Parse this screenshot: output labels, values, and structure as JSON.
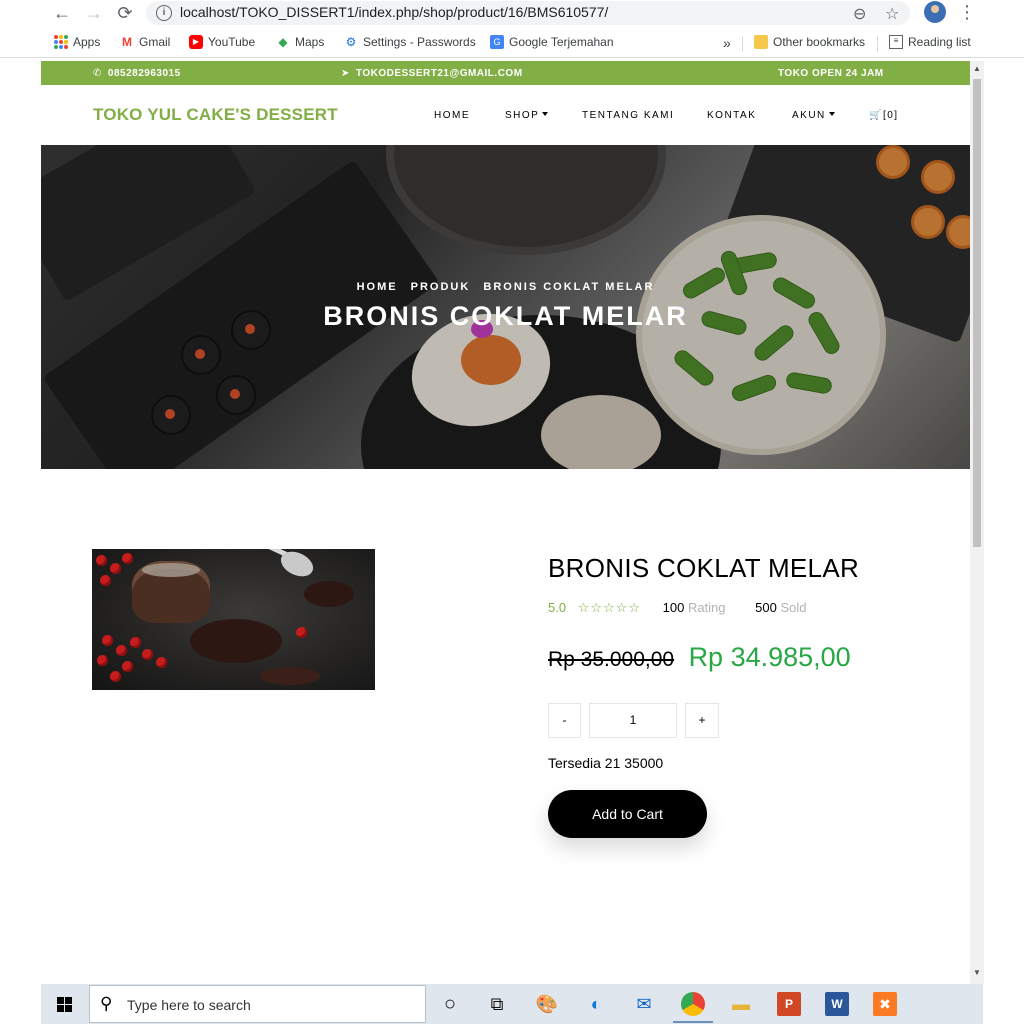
{
  "browser": {
    "url_host": "localhost",
    "url_path": "/TOKO_DISSERT1/index.php/shop/product/16/BMS610577/",
    "bookmarks": [
      {
        "label": "Apps",
        "icon": "apps-grid-icon"
      },
      {
        "label": "Gmail",
        "icon": "gmail-icon"
      },
      {
        "label": "YouTube",
        "icon": "youtube-icon"
      },
      {
        "label": "Maps",
        "icon": "maps-icon"
      },
      {
        "label": "Settings - Passwords",
        "icon": "settings-gear-icon"
      },
      {
        "label": "Google Terjemahan",
        "icon": "translate-icon"
      }
    ],
    "overflow": "»",
    "other_bookmarks": "Other bookmarks",
    "reading_list": "Reading list"
  },
  "topbar": {
    "phone": "085282963015",
    "email": "TOKODESSERT21@GMAIL.COM",
    "hours": "TOKO OPEN 24 JAM",
    "bg_color": "#82ae46"
  },
  "navbar": {
    "brand": "TOKO YUL CAKE'S DESSERT",
    "items": [
      "HOME",
      "SHOP",
      "TENTANG KAMI",
      "KONTAK",
      "AKUN"
    ],
    "cart": "[0]"
  },
  "hero": {
    "breadcrumbs": [
      "HOME",
      "PRODUK",
      "BRONIS COKLAT MELAR"
    ],
    "title": "BRONIS COKLAT MELAR"
  },
  "product": {
    "name": "BRONIS COKLAT MELAR",
    "rating": "5.0",
    "stars": "☆☆☆☆☆",
    "rating_count": "100",
    "rating_label": "Rating",
    "sold_count": "500",
    "sold_label": "Sold",
    "old_price": "Rp 35.000,00",
    "new_price": "Rp 34.985,00",
    "qty_minus": "-",
    "qty_value": "1",
    "qty_plus": "+",
    "stock_text": "Tersedia 21 35000",
    "add_to_cart": "Add to Cart",
    "accent_color": "#82ae46",
    "price_color": "#28a745"
  },
  "taskbar": {
    "search_placeholder": "Type here to search"
  }
}
